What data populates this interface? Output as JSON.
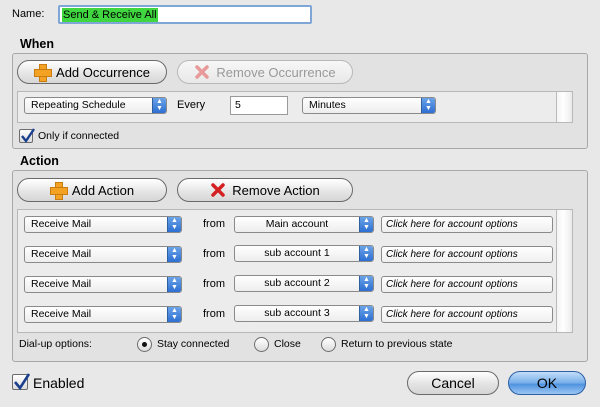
{
  "name": {
    "label": "Name:",
    "value": "Send & Receive All"
  },
  "when": {
    "title": "When",
    "add_label": "Add Occurrence",
    "remove_label": "Remove Occurrence",
    "schedule": "Repeating Schedule",
    "every_label": "Every",
    "every_value": "5",
    "unit": "Minutes",
    "only_if_connected": "Only if connected"
  },
  "action": {
    "title": "Action",
    "add_label": "Add Action",
    "remove_label": "Remove Action",
    "from_label": "from",
    "rows": [
      {
        "action": "Receive Mail",
        "account": "Main account",
        "options": "Click here for account options"
      },
      {
        "action": "Receive Mail",
        "account": "sub account 1",
        "options": "Click here for account options"
      },
      {
        "action": "Receive Mail",
        "account": "sub account 2",
        "options": "Click here for account options"
      },
      {
        "action": "Receive Mail",
        "account": "sub account 3",
        "options": "Click here for account options"
      }
    ],
    "dialup_label": "Dial-up options:",
    "dialup_options": [
      "Stay connected",
      "Close",
      "Return to previous state"
    ],
    "dialup_selected": "Stay connected"
  },
  "footer": {
    "enabled": "Enabled",
    "cancel": "Cancel",
    "ok": "OK"
  },
  "colors": {
    "selection": "#3fd63f",
    "accent": "#4e92e0",
    "focus": "#7ea7d8"
  }
}
